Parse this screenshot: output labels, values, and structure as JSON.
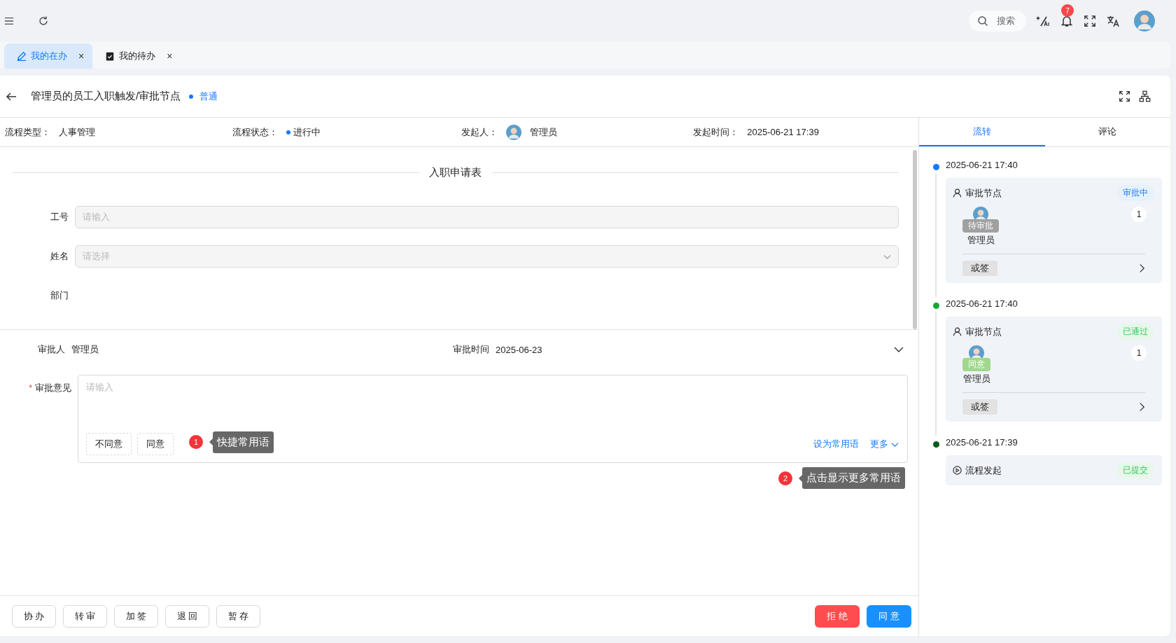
{
  "topbar": {
    "search_placeholder": "搜索",
    "notification_count": "7"
  },
  "tabs": [
    {
      "label": "我的在办",
      "selected": true,
      "kind": "edit",
      "close": "×"
    },
    {
      "label": "我的待办",
      "selected": false,
      "kind": "clipboard",
      "close": "×"
    }
  ],
  "header": {
    "title": "管理员的员工入职触发/审批节点",
    "priority": "普通"
  },
  "info": [
    {
      "label": "流程类型：",
      "value": "人事管理",
      "kind": "text"
    },
    {
      "label": "流程状态：",
      "value": "进行中",
      "kind": "status"
    },
    {
      "label": "发起人：",
      "value": "管理员",
      "kind": "person"
    },
    {
      "label": "发起时间：",
      "value": "2025-06-21 17:39",
      "kind": "text"
    }
  ],
  "form": {
    "title": "入职申请表",
    "fields": [
      {
        "label": "工号",
        "placeholder": "请输入",
        "kind": "input"
      },
      {
        "label": "姓名",
        "placeholder": "请选择",
        "kind": "select"
      },
      {
        "label": "部门",
        "kind": "empty"
      }
    ]
  },
  "approval": {
    "required_mark": "*",
    "approver_label": "审批人",
    "approver": "管理员",
    "time_label": "审批时间",
    "time": "2025-06-23",
    "opinion_label": "审批意见",
    "opinion_placeholder": "请输入",
    "phrases": [
      "不同意",
      "同意"
    ],
    "set_common": "设为常用语",
    "more": "更多"
  },
  "hints": [
    {
      "number": "1",
      "text": "快捷常用语"
    },
    {
      "number": "2",
      "text": "点击显示更多常用语"
    }
  ],
  "actions": [
    "协 办",
    "转 审",
    "加 签",
    "退 回",
    "暂 存"
  ],
  "decisions": [
    {
      "label": "拒 绝",
      "kind": "reject"
    },
    {
      "label": "同 意",
      "kind": "approve"
    }
  ],
  "side_tabs": [
    {
      "label": "流转",
      "selected": true
    },
    {
      "label": "评论",
      "selected": false
    }
  ],
  "timeline": [
    {
      "time": "2025-06-21 17:40",
      "color": "#1677ff",
      "kind": "approval",
      "node": "审批节点",
      "status": "审批中",
      "status_pending": true,
      "person_badge": "待审批",
      "agreed": false,
      "person": "管理员",
      "count": "1",
      "sign": "或签"
    },
    {
      "time": "2025-06-21 17:40",
      "color": "#13a832",
      "kind": "approval",
      "node": "审批节点",
      "status": "已通过",
      "status_pending": false,
      "person_badge": "同意",
      "agreed": true,
      "person": "管理员",
      "count": "1",
      "sign": "或签"
    },
    {
      "time": "2025-06-21 17:39",
      "color": "#0c5a1c",
      "kind": "start",
      "node": "流程发起",
      "status": "已提交",
      "status_pending": false
    }
  ]
}
